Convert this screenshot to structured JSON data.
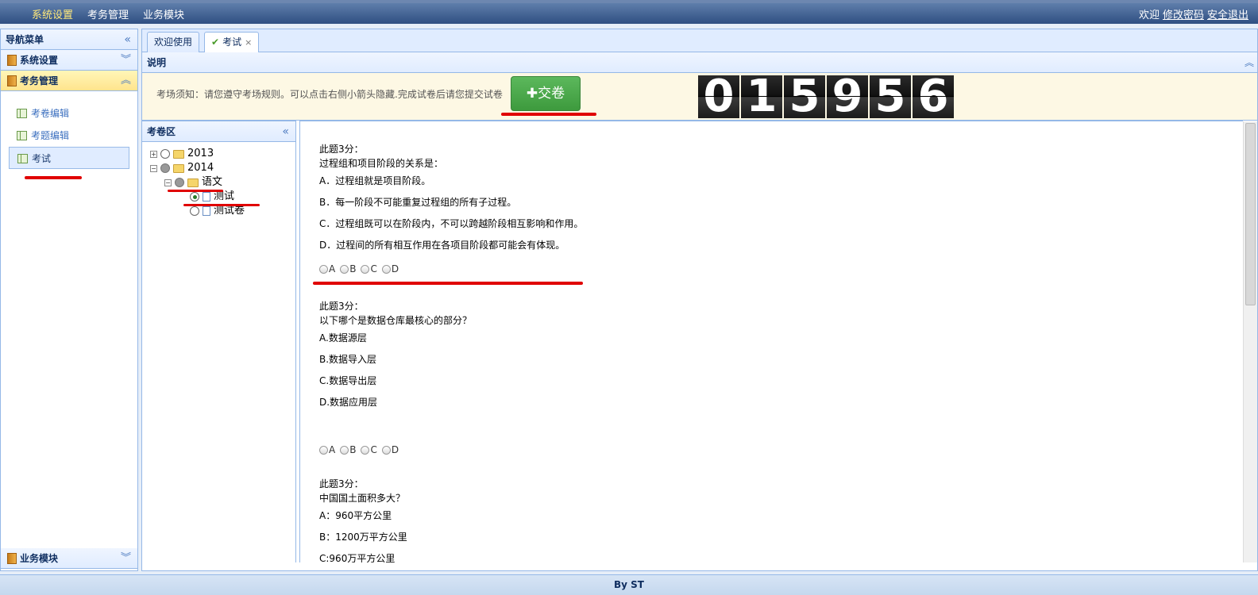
{
  "topbar": {
    "menu": [
      "系统设置",
      "考务管理",
      "业务模块"
    ],
    "welcome": "欢迎",
    "change_password": "修改密码",
    "logout": "安全退出"
  },
  "leftnav": {
    "title": "导航菜单",
    "sections": {
      "system": "系统设置",
      "exam": "考务管理",
      "business": "业务模块"
    },
    "items": [
      "考卷编辑",
      "考题编辑",
      "考试"
    ]
  },
  "tabs": [
    "欢迎使用",
    "考试"
  ],
  "description": {
    "title": "说明",
    "notice": "考场须知：请您遵守考场规则。可以点击右侧小箭头隐藏.完成试卷后请您提交试卷",
    "submit_label": "✚交卷",
    "timer_digits": [
      "0",
      "1",
      "5",
      "9",
      "5",
      "6"
    ]
  },
  "tree": {
    "title": "考卷区",
    "nodes": [
      "2013",
      "2014",
      "语文",
      "测试",
      "测试卷"
    ]
  },
  "questions": [
    {
      "score": "此题3分：",
      "text": "过程组和项目阶段的关系是：",
      "options": [
        "A．过程组就是项目阶段。",
        "B．每一阶段不可能重复过程组的所有子过程。",
        "C．过程组既可以在阶段内，不可以跨越阶段相互影响和作用。",
        "D．过程间的所有相互作用在各项目阶段都可能会有体现。"
      ]
    },
    {
      "score": "此题3分：",
      "text": "以下哪个是数据仓库最核心的部分？",
      "options": [
        "A.数据源层",
        "B.数据导入层",
        "C.数据导出层",
        "D.数据应用层"
      ]
    },
    {
      "score": "此题3分：",
      "text": "中国国土面积多大？",
      "options": [
        "A：960平方公里",
        "B：1200万平方公里",
        "C:960万平方公里"
      ]
    }
  ],
  "answer_choices": [
    "A",
    "B",
    "C",
    "D"
  ],
  "footer": "By ST",
  "colors": {
    "annotation": "#e00000",
    "submit": "#4cae4c",
    "header": "#2f4f82"
  }
}
